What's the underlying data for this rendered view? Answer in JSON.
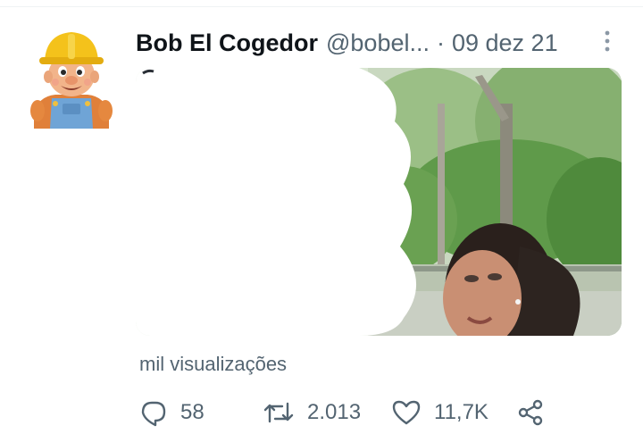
{
  "tweet": {
    "author": {
      "display_name": "Bob El Cogedor",
      "handle": "@bobel...",
      "avatar_icon": "bob-the-builder-avatar"
    },
    "separator": "·",
    "date": "09 dez 21",
    "more_icon": "more-vertical-icon",
    "views_text": "mil visualizações",
    "actions": {
      "reply": {
        "icon": "reply-icon",
        "count": "58"
      },
      "retweet": {
        "icon": "retweet-icon",
        "count": "2.013"
      },
      "like": {
        "icon": "heart-icon",
        "count": "11,7K"
      },
      "share": {
        "icon": "share-icon"
      }
    }
  },
  "colors": {
    "text_primary": "#0f1419",
    "text_secondary": "#536471",
    "divider": "#eff3f4"
  }
}
